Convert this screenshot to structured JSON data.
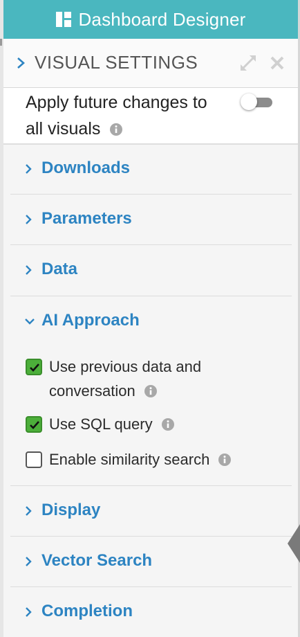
{
  "title_bar": {
    "title": "Dashboard Designer",
    "bg_color": "#4ab7bf",
    "icon": "dashboard-grid-icon"
  },
  "visual_settings": {
    "header_label": "VISUAL SETTINGS",
    "apply_future_changes": {
      "label_line1": "Apply future changes to",
      "label_line2": "all visuals",
      "toggle_on": false
    }
  },
  "sections": {
    "downloads": "Downloads",
    "parameters": "Parameters",
    "data": "Data",
    "ai_approach": {
      "label": "AI Approach",
      "expanded": true,
      "options": [
        {
          "line1": "Use previous data and",
          "line2": "conversation",
          "checked": true
        },
        {
          "line1": "Use SQL query",
          "checked": true
        },
        {
          "line1": "Enable similarity search",
          "checked": false
        }
      ]
    },
    "display": "Display",
    "vector_search": "Vector Search",
    "completion": "Completion"
  },
  "colors": {
    "section_label": "#2d84c2",
    "checkbox_checked": "#4caf3a"
  }
}
